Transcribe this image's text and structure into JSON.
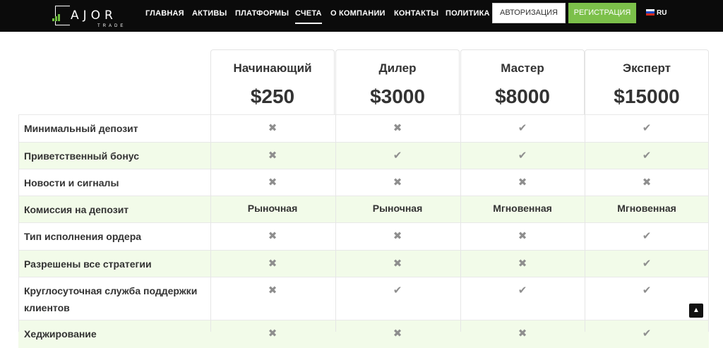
{
  "logo": {
    "text": "AJOR",
    "sub": "TRADE"
  },
  "nav": {
    "items": [
      "ГЛАВНАЯ",
      "АКТИВЫ",
      "ПЛАТФОРМЫ",
      "СЧЕТА",
      "О КОМПАНИИ",
      "КОНТАКТЫ",
      "ПОЛИТИКА"
    ],
    "active": "СЧЕТА",
    "login_label": "АВТОРИЗАЦИЯ",
    "register_label": "РЕГИСТРАЦИЯ",
    "language": "RU"
  },
  "colors": {
    "accent": "#7cc04a",
    "row_alt": "#f2fbe9",
    "navbar": "#0b0b0b"
  },
  "plans": [
    {
      "name": "Начинающий",
      "price": "$250"
    },
    {
      "name": "Дилер",
      "price": "$3000"
    },
    {
      "name": "Мастер",
      "price": "$8000"
    },
    {
      "name": "Эксперт",
      "price": "$15000"
    }
  ],
  "rows": [
    {
      "label": "Минимальный депозит",
      "values": [
        "no",
        "no",
        "yes",
        "yes"
      ]
    },
    {
      "label": "Приветственный бонус",
      "values": [
        "no",
        "yes",
        "yes",
        "yes"
      ]
    },
    {
      "label": "Новости и сигналы",
      "values": [
        "no",
        "no",
        "no",
        "no"
      ]
    },
    {
      "label": "Комиссия на депозит",
      "values": [
        "Рыночная",
        "Рыночная",
        "Мгновенная",
        "Мгновенная"
      ]
    },
    {
      "label": "Тип исполнения ордера",
      "values": [
        "no",
        "no",
        "no",
        "yes"
      ]
    },
    {
      "label": "Разрешены все стратегии",
      "values": [
        "no",
        "no",
        "no",
        "yes"
      ]
    },
    {
      "label": "Круглосуточная служба поддержки клиентов",
      "values": [
        "no",
        "yes",
        "yes",
        "yes"
      ]
    },
    {
      "label": "Хеджирование",
      "values": [
        "no",
        "no",
        "no",
        "yes"
      ]
    }
  ],
  "icons": {
    "yes": "check-icon",
    "no": "cross-icon",
    "scroll": "chevron-up-icon"
  }
}
